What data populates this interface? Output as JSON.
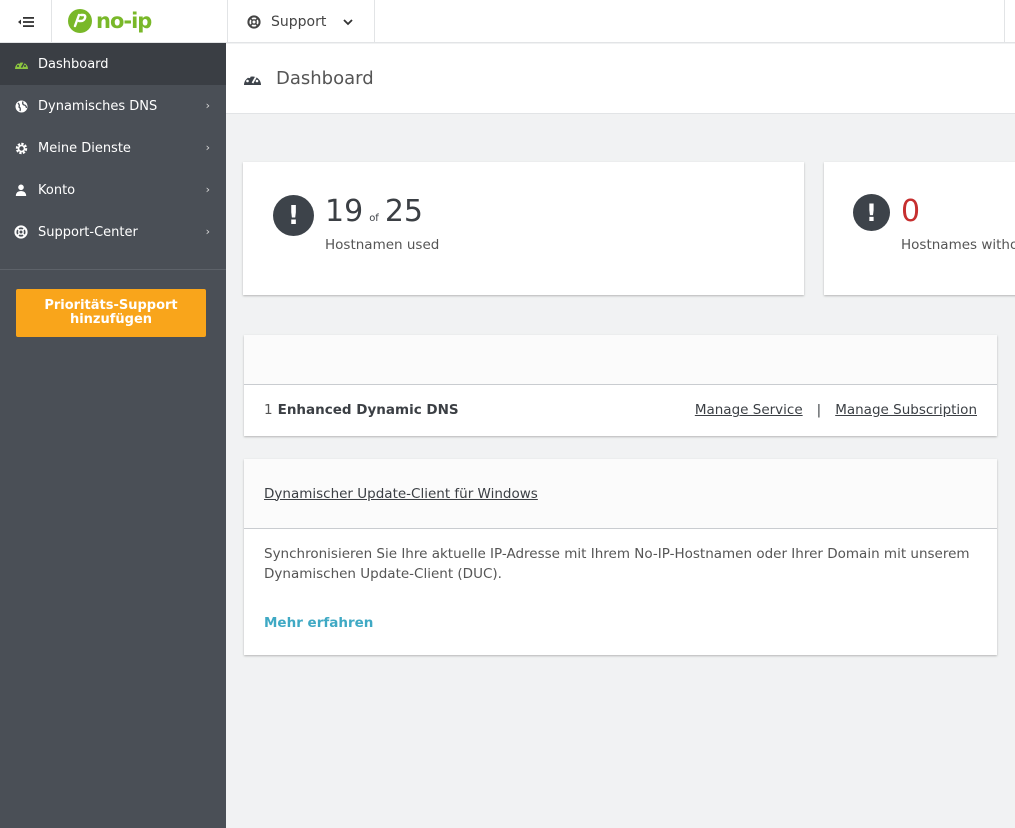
{
  "topbar": {
    "logo_text": "no-ip",
    "support_label": "Support"
  },
  "sidebar": {
    "items": [
      {
        "label": "Dashboard",
        "icon": "dashboard-icon",
        "active": true
      },
      {
        "label": "Dynamisches DNS",
        "icon": "globe-icon"
      },
      {
        "label": "Meine Dienste",
        "icon": "gear-icon"
      },
      {
        "label": "Konto",
        "icon": "user-icon"
      },
      {
        "label": "Support-Center",
        "icon": "lifebuoy-icon"
      }
    ],
    "priority_button": "Prioritäts-Support hinzufügen"
  },
  "header": {
    "title": "Dashboard"
  },
  "stats": [
    {
      "value": "19",
      "of": "of",
      "total": "25",
      "label": "Hostnamen used"
    },
    {
      "value": "0",
      "label": "Hostnames witho"
    }
  ],
  "service": {
    "count": "1",
    "name": "Enhanced Dynamic DNS",
    "manage_service": "Manage Service",
    "separator": "|",
    "manage_subscription": "Manage Subscription"
  },
  "duc": {
    "title": "Dynamischer Update-Client für Windows",
    "description": "Synchronisieren Sie Ihre aktuelle IP-Adresse mit Ihrem No-IP-Hostnamen oder Ihrer Domain mit unserem Dynamischen Update-Client (DUC).",
    "more": "Mehr erfahren"
  },
  "colors": {
    "sidebar": "#4a4f56",
    "sidebar_active": "#3a3e44",
    "brand_green": "#79b829",
    "priority_orange": "#f9a51b",
    "link_teal": "#3fa9c4",
    "alert_red": "#c62f2f"
  }
}
